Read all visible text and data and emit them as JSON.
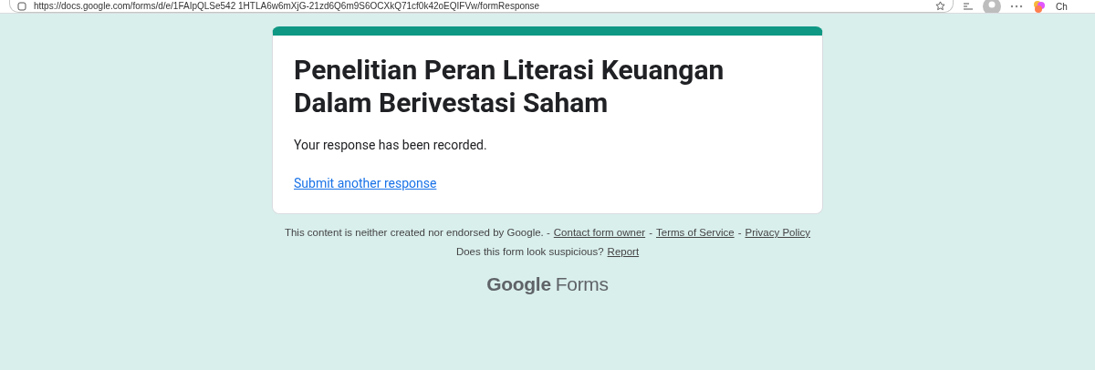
{
  "browser": {
    "url": "https://docs.google.com/forms/d/e/1FAIpQLSe542 1HTLA6w6mXjG-21zd6Q6m9S6OCXkQ71cf0k42oEQIFVw/formResponse",
    "profile_label": "Ch"
  },
  "form": {
    "title": "Penelitian Peran Literasi Keuangan Dalam Berivestasi Saham",
    "message": "Your response has been recorded.",
    "link": "Submit another response"
  },
  "footer": {
    "disclaimer": "This content is neither created nor endorsed by Google. -",
    "links": [
      "Contact form owner",
      "Terms of Service",
      "Privacy Policy"
    ],
    "separator": "-",
    "question": "Does this form look suspicious?",
    "report": "Report",
    "brand": [
      "Google",
      "Forms"
    ]
  }
}
